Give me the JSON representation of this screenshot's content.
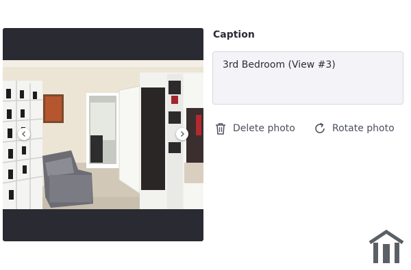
{
  "caption": {
    "label": "Caption",
    "value": "3rd Bedroom (View #3)"
  },
  "actions": {
    "delete_label": "Delete photo",
    "delete_icon": "trash-icon",
    "rotate_label": "Rotate photo",
    "rotate_icon": "rotate-icon"
  },
  "gallery": {
    "prev_icon": "chevron-left-icon",
    "next_icon": "chevron-right-icon"
  },
  "colors": {
    "photo_frame": "#2a2a33",
    "text": "#2b2b36",
    "action_text": "#4a4f5c",
    "logo": "#5b5f66"
  }
}
